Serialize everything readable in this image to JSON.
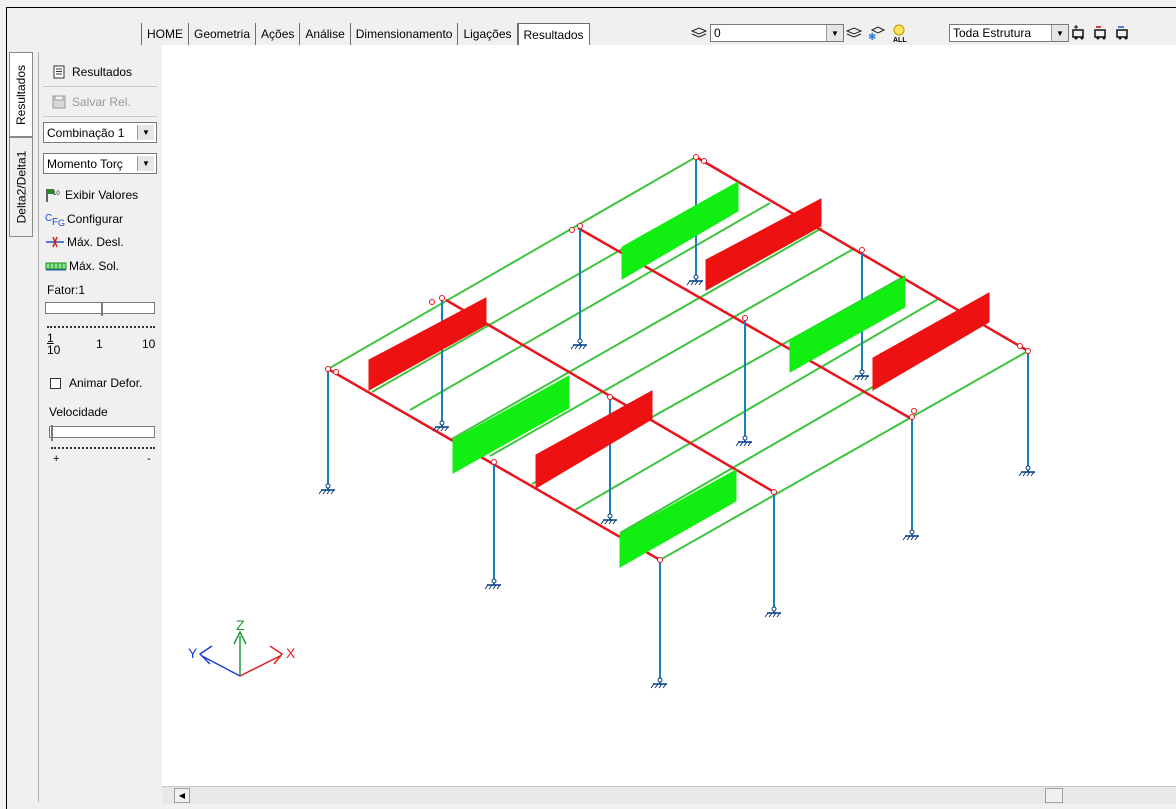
{
  "menu": {
    "items": [
      {
        "label": "HOME"
      },
      {
        "label": "Geometria"
      },
      {
        "label": "Ações"
      },
      {
        "label": "Análise"
      },
      {
        "label": "Dimensionamento"
      },
      {
        "label": "Ligações"
      },
      {
        "label": "Resultados"
      }
    ],
    "active_index": 6
  },
  "toolbar": {
    "layer_value": "0",
    "structure_value": "Toda Estrutura",
    "icons": [
      "layers-icon",
      "layer-off-icon",
      "layer-snow-icon",
      "light-all-icon",
      "truck-add-icon",
      "truck-remove-icon",
      "truck-swap-icon"
    ]
  },
  "tabs": {
    "vertical": [
      {
        "label": "Resultados"
      },
      {
        "label": "Delta2/Delta1"
      }
    ]
  },
  "panel": {
    "results_label": "Resultados",
    "save_label": "Salvar Rel.",
    "combination_value": "Combinação 1",
    "effort_value": "Momento Torç",
    "show_values_label": "Exibir Valores",
    "configure_label": "Configurar",
    "max_disp_label": "Máx. Desl.",
    "max_sol_label": "Máx. Sol.",
    "factor_label": "Fator:1",
    "scale_min_num": "1",
    "scale_min_den": "10",
    "scale_mid": "1",
    "scale_max": "10",
    "animate_label": "Animar Defor.",
    "speed_label": "Velocidade",
    "speed_plus": "+",
    "speed_minus": "-"
  },
  "axes": {
    "x": "X",
    "y": "Y",
    "z": "Z"
  },
  "colors": {
    "beam": "#e8141e",
    "beam_alt": "#3ec43e",
    "column": "#1a7fb8",
    "neg": "#ee1111",
    "pos": "#11ee11"
  }
}
